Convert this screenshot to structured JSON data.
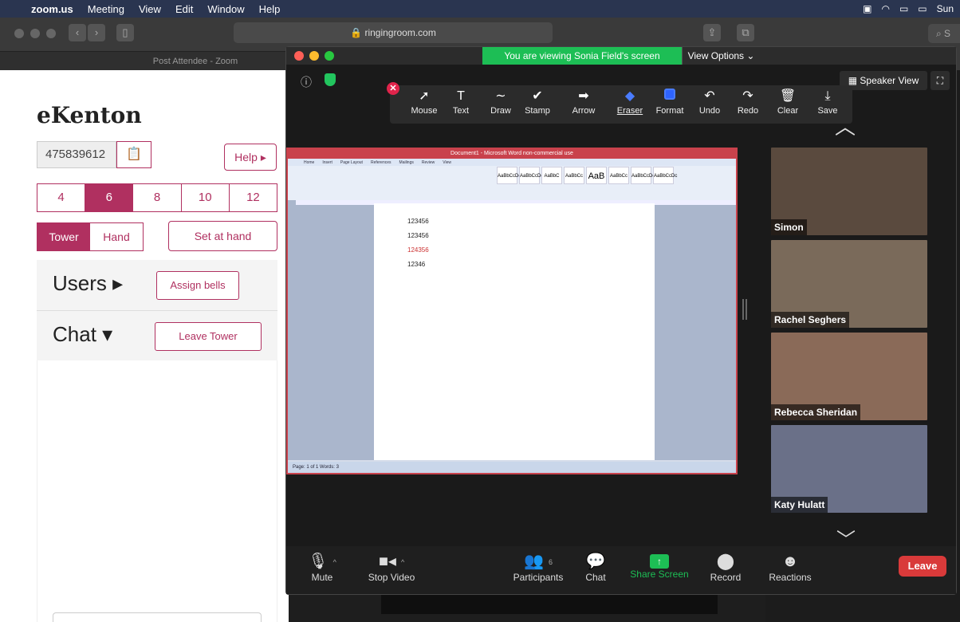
{
  "menubar": {
    "app": "zoom.us",
    "items": [
      "Meeting",
      "View",
      "Edit",
      "Window",
      "Help"
    ],
    "clock": "Sun"
  },
  "browser": {
    "url": "ringingroom.com",
    "tab_title": "Post Attendee - Zoom"
  },
  "ekenton": {
    "brand": "eKenton",
    "tower_id": "475839612",
    "help_label": "Help ▸",
    "sizes": [
      "4",
      "6",
      "8",
      "10",
      "12"
    ],
    "selected_size": "6",
    "view_modes": [
      "Tower",
      "Hand"
    ],
    "selected_view": "Tower",
    "set_at_hand": "Set at hand",
    "users_title": "Users ▸",
    "assign_bells": "Assign bells",
    "chat_title": "Chat ▾",
    "leave_tower": "Leave Tower"
  },
  "zoom": {
    "banner": "You are viewing Sonia Field's screen",
    "view_options": "View Options ⌄",
    "speaker_view": "Speaker View",
    "annotate_tools": [
      {
        "label": "Mouse",
        "icon": "mouse-icon",
        "glyph": "➚"
      },
      {
        "label": "Text",
        "icon": "text-icon",
        "glyph": "T"
      },
      {
        "label": "Draw",
        "icon": "draw-icon",
        "glyph": "∼"
      },
      {
        "label": "Stamp",
        "icon": "stamp-icon",
        "glyph": "✔"
      },
      {
        "label": "Arrow",
        "icon": "arrow-icon",
        "glyph": "➡"
      },
      {
        "label": "Eraser",
        "icon": "eraser-icon",
        "glyph": "◆"
      },
      {
        "label": "Format",
        "icon": "format-icon",
        "glyph": ""
      },
      {
        "label": "Undo",
        "icon": "undo-icon",
        "glyph": "↶"
      },
      {
        "label": "Redo",
        "icon": "redo-icon",
        "glyph": "↷"
      },
      {
        "label": "Clear",
        "icon": "trash-icon",
        "glyph": "🗑"
      },
      {
        "label": "Save",
        "icon": "save-icon",
        "glyph": "⤓"
      }
    ],
    "shared_doc": {
      "word_title": "Document1 - Microsoft Word non-commercial use",
      "lines": [
        "123456",
        "123456",
        "124356",
        "12346"
      ],
      "statusbar": "Page: 1 of 1   Words: 3"
    },
    "participants": [
      {
        "name": "Simon",
        "bg": "#5a4a3e"
      },
      {
        "name": "Rachel Seghers",
        "bg": "#7a6a5a"
      },
      {
        "name": "Rebecca Sheridan",
        "bg": "#8a6a58"
      },
      {
        "name": "Katy Hulatt",
        "bg": "#6a7088"
      }
    ],
    "controls": {
      "mute": "Mute",
      "stop_video": "Stop Video",
      "participants": "Participants",
      "participant_count": "6",
      "chat": "Chat",
      "share_screen": "Share Screen",
      "record": "Record",
      "reactions": "Reactions",
      "leave": "Leave"
    }
  },
  "colors": {
    "accent": "#b03060",
    "zoom_green": "#1dbe55",
    "leave_red": "#d93a3a"
  }
}
